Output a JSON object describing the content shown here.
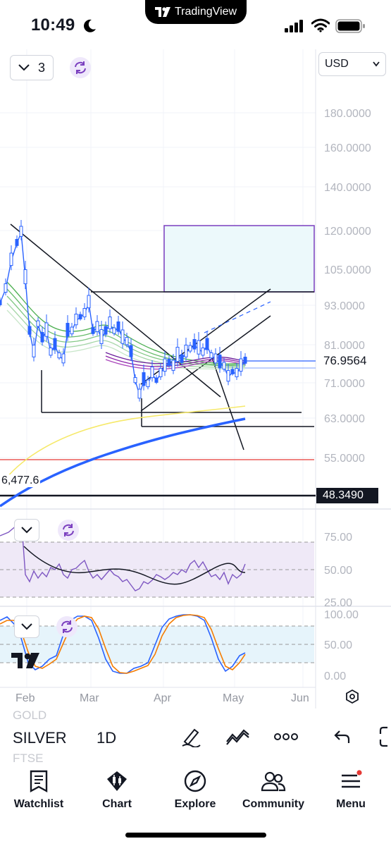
{
  "status_bar": {
    "time": "10:49",
    "app_pill": "TradingView"
  },
  "chart_header": {
    "interval_count": "3",
    "currency": "USD"
  },
  "price_axis": {
    "labels": [
      "180.0000",
      "160.0000",
      "140.0000",
      "120.0000",
      "105.0000",
      "93.0000",
      "81.0000",
      "71.0000",
      "63.0000",
      "55.0000"
    ],
    "current_price": "76.9564",
    "highlight_price": "48.3490",
    "left_value": "6,477.6"
  },
  "rsi_pane": {
    "labels": [
      "75.00",
      "50.00",
      "25.00"
    ]
  },
  "stoch_pane": {
    "labels": [
      "100.00",
      "50.00",
      "0.00"
    ]
  },
  "time_axis": {
    "months": [
      "Feb",
      "Mar",
      "Apr",
      "May",
      "Jun"
    ]
  },
  "toolbar": {
    "ghost_above": "GOLD",
    "symbol": "SILVER",
    "ghost_below": "FTSE",
    "timeframe": "1D"
  },
  "nav": {
    "items": [
      {
        "label": "Watchlist",
        "icon": "watchlist-icon"
      },
      {
        "label": "Chart",
        "icon": "chart-icon"
      },
      {
        "label": "Explore",
        "icon": "compass-icon"
      },
      {
        "label": "Community",
        "icon": "community-icon"
      },
      {
        "label": "Menu",
        "icon": "menu-icon"
      }
    ]
  },
  "colors": {
    "rsi_band": "#efe9f7",
    "stoch_band": "#e6f4fb",
    "ma_blue": "#2962ff",
    "ma_yellow": "#f6e96a",
    "red_line": "#e53935",
    "box_fill": "#ecf9fb",
    "box_stroke": "#7b3fbf",
    "notification": "#e53935"
  }
}
